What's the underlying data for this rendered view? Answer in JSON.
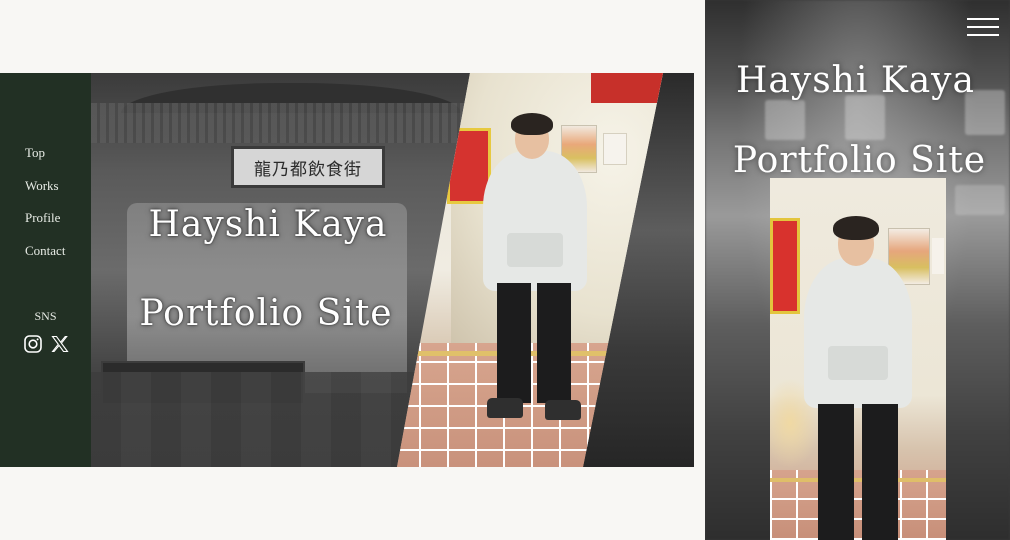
{
  "desktop": {
    "nav": {
      "top": "Top",
      "works": "Works",
      "profile": "Profile",
      "contact": "Contact"
    },
    "sns_label": "SNS",
    "sns_icons": [
      "instagram-icon",
      "x-icon"
    ],
    "hero": {
      "sign_text": "龍乃都飲食街",
      "title_line1": "Hayshi Kaya",
      "title_line2": "Portfolio Site"
    }
  },
  "mobile": {
    "menu_icon": "hamburger-menu-icon",
    "title_line1": "Hayshi Kaya",
    "title_line2": "Portfolio Site"
  },
  "colors": {
    "sidebar_bg": "#223024",
    "page_bg": "#f8f7f4",
    "title_text": "#ffffff"
  }
}
